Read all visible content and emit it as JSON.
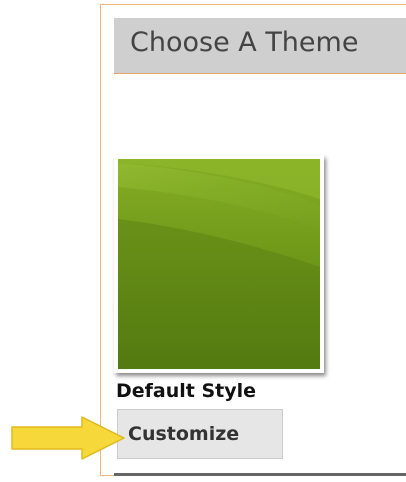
{
  "panel": {
    "title": "Choose A Theme"
  },
  "theme": {
    "name": "Default Style",
    "colors": {
      "dark": "#4e7413",
      "mid": "#6f9a1c",
      "light": "#93bd2e"
    }
  },
  "actions": {
    "customize_label": "Customize"
  },
  "pointer": {
    "icon": "arrow-right-icon",
    "color": "#f7d83a"
  }
}
